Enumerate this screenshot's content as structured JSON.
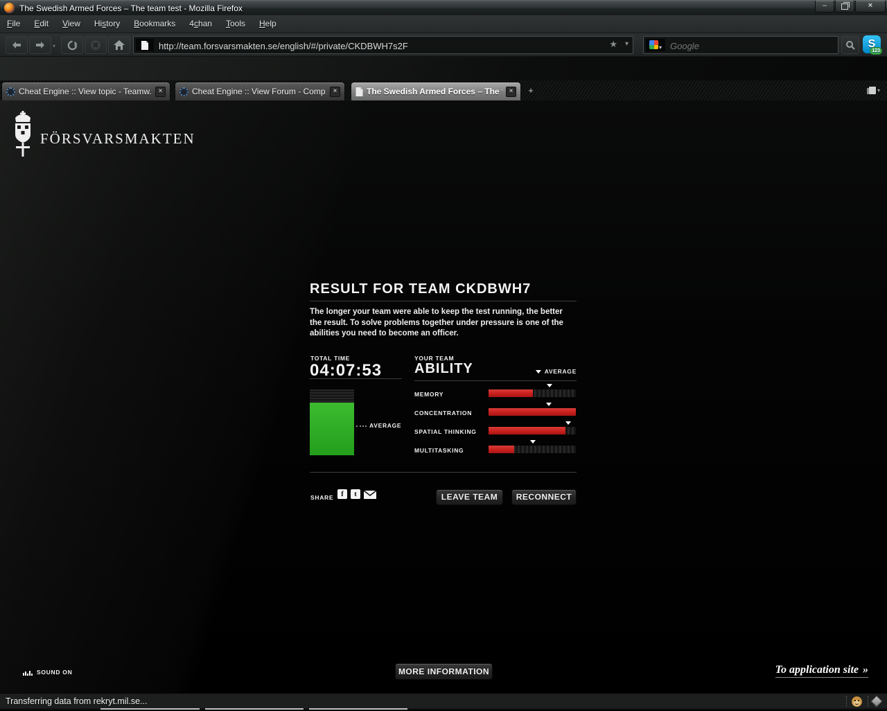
{
  "window": {
    "title": "The Swedish Armed Forces – The team test - Mozilla Firefox"
  },
  "menu": {
    "items": [
      {
        "pre": "",
        "accel": "F",
        "post": "ile"
      },
      {
        "pre": "",
        "accel": "E",
        "post": "dit"
      },
      {
        "pre": "",
        "accel": "V",
        "post": "iew"
      },
      {
        "pre": "Hi",
        "accel": "s",
        "post": "tory"
      },
      {
        "pre": "",
        "accel": "B",
        "post": "ookmarks"
      },
      {
        "pre": "4",
        "accel": "c",
        "post": "han"
      },
      {
        "pre": "",
        "accel": "T",
        "post": "ools"
      },
      {
        "pre": "",
        "accel": "H",
        "post": "elp"
      }
    ]
  },
  "toolbar": {
    "url": "http://team.forsvarsmakten.se/english/#/private/CKDBWH7s2F",
    "skype_badge": "123"
  },
  "search": {
    "placeholder": "Google",
    "engine": "Google"
  },
  "tabs": [
    {
      "title": "Cheat Engine :: View topic - Teamw..."
    },
    {
      "title": "Cheat Engine :: View Forum - Comp..."
    },
    {
      "title": "The Swedish Armed Forces – The t..."
    }
  ],
  "icons": {
    "close_tab": "×",
    "new_tab": "+",
    "window_minimize": "–",
    "window_close": "×",
    "bookmark_star": "★",
    "dropdown_caret": "▾",
    "chevrons": "»",
    "skype_letter": "S",
    "facebook_letter": "f",
    "twitter_letter": "t"
  },
  "page": {
    "brand": "FÖRSVARSMAKTEN",
    "heading": "RESULT FOR TEAM CKDBWH7",
    "description": "The longer your team were able to keep the test running, the better the result. To solve problems together under pressure is one of the abilities you need to become an officer.",
    "total_time_label": "TOTAL TIME",
    "total_time": "04:07:53",
    "your_team_label": "YOUR TEAM",
    "ability_label": "ABILITY",
    "average_label": "AVERAGE",
    "share_label": "SHARE",
    "leave_team_button": "LEAVE TEAM",
    "reconnect_button": "RECONNECT",
    "more_information_button": "MORE INFORMATION",
    "to_application_site": "To application site",
    "sound_on": "SOUND ON"
  },
  "chart_data": {
    "type": "bar",
    "title": "YOUR TEAM ABILITY",
    "note": "value = percent of track filled (red); average = position of white marker, percent of track. team_bar is the green vertical result bar vs dotted average line.",
    "abilities": [
      {
        "label": "MEMORY",
        "value": 51,
        "average": 70
      },
      {
        "label": "CONCENTRATION",
        "value": 100,
        "average": 69
      },
      {
        "label": "SPATIAL THINKING",
        "value": 88,
        "average": 91
      },
      {
        "label": "MULTITASKING",
        "value": 29,
        "average": 51
      }
    ],
    "team_bar": {
      "fill_pct": 80,
      "average_from_top_pct": 55
    }
  },
  "statusbar": {
    "text": "Transferring data from rekryt.mil.se..."
  },
  "colors": {
    "accent_red": "#c71f1d",
    "accent_green": "#2fae24"
  }
}
